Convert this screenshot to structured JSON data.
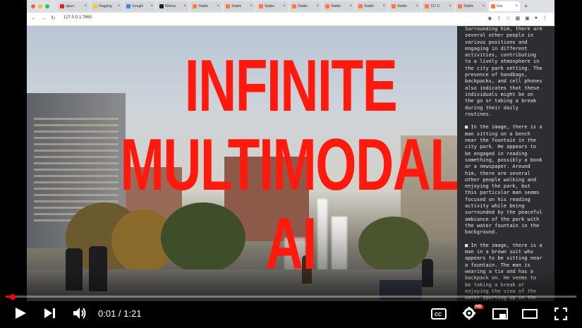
{
  "browser": {
    "url": "127.0.0.1:7860",
    "tabs": [
      {
        "label": "apurv",
        "color": "#e62117"
      },
      {
        "label": "Hugging",
        "color": "#f7c52b"
      },
      {
        "label": "Google",
        "color": "#4285f4"
      },
      {
        "label": "Walrus",
        "color": "#222"
      },
      {
        "label": "Stable",
        "color": "#ff7a3d"
      },
      {
        "label": "Stable",
        "color": "#ff7a3d"
      },
      {
        "label": "Stable",
        "color": "#ff7a3d"
      },
      {
        "label": "Stable",
        "color": "#ff7a3d"
      },
      {
        "label": "Stable",
        "color": "#ff7a3d"
      },
      {
        "label": "Stable",
        "color": "#ff7a3d"
      },
      {
        "label": "Stable",
        "color": "#ff7a3d"
      },
      {
        "label": "127.0.",
        "color": "#ff7a3d"
      },
      {
        "label": "Stable",
        "color": "#ff7a3d"
      },
      {
        "label": "Gra",
        "color": "#ff7a3d"
      }
    ]
  },
  "overlay": {
    "line1": "INFINITE",
    "line2": "MULTIMODAL",
    "line3": "AI",
    "color": "#ff1a0d"
  },
  "panel_text": "Surrounding him, there are\nseveral other people in\nvarious positions and\nengaging in different\nactivities, contributing\nto a lively atmosphere in\nthe city park setting. The\npresence of handbags,\nbackpacks, and cell phones\nalso indicates that these\nindividuals might be on\nthe go or taking a break\nduring their daily\nroutines.\n\n■ In the image, there is a\nman sitting on a bench\nnear the fountain in the\ncity park. He appears to\nbe engaged in reading\nsomething, possibly a book\nor a newspaper. Around\nhim, there are several\nother people walking and\nenjoying the park, but\nthis particular man seems\nfocused on his reading\nactivity while being\nsurrounded by the peaceful\nambiance of the park with\nthe water fountain in the\nbackground.\n\n■ In the image, there is a\nman in a brown suit who\nappears to be sitting near\na fountain. The man is\nwearing a tie and has a\nbackpack on. He seems to\nbe taking a break or\nenjoying the view of the\nwater spurting up in the\ncenter of the surrounding",
  "player": {
    "time": "0:01 / 1:21",
    "progress_fraction": 0.012,
    "hd_badge": "HD",
    "accent": "#ff0000"
  }
}
